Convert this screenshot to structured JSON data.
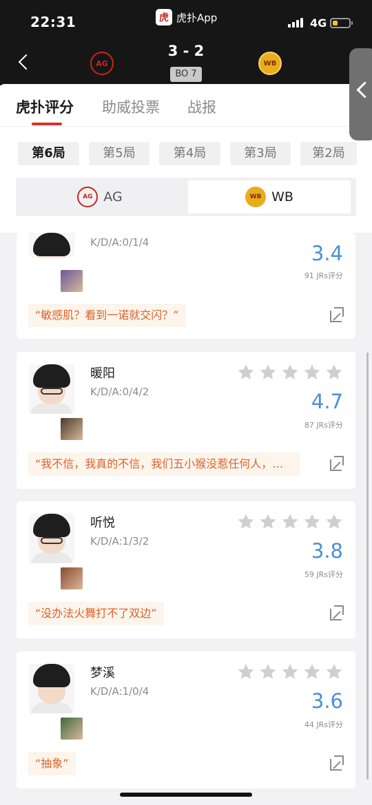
{
  "status_bar": {
    "time": "22:31",
    "app_name": "虎扑App",
    "app_logo_char": "虎",
    "network": "4G",
    "battery_level": 0.3
  },
  "match": {
    "score": "3 - 2",
    "format": "BO 7",
    "team_left_logo": "AG",
    "team_right_logo": "WB"
  },
  "tabs": [
    {
      "label": "虎扑评分",
      "active": true
    },
    {
      "label": "助威投票",
      "active": false
    },
    {
      "label": "战报",
      "active": false
    }
  ],
  "games": [
    {
      "label": "第6局",
      "active": true
    },
    {
      "label": "第5局",
      "active": false
    },
    {
      "label": "第4局",
      "active": false
    },
    {
      "label": "第3局",
      "active": false
    },
    {
      "label": "第2局",
      "active": false
    }
  ],
  "team_toggle": {
    "left": {
      "label": "AG",
      "active": false
    },
    "right": {
      "label": "WB",
      "active": true
    }
  },
  "players": [
    {
      "name": "",
      "kda": "K/D/A:0/1/4",
      "rating": "3.4",
      "votes": "91 JRs评分",
      "quote": "“敏感肌？看到一诺就交闪？”",
      "stars_filled": 0,
      "glasses": false,
      "hero_color": "#6a5a9a"
    },
    {
      "name": "暖阳",
      "kda": "K/D/A:0/4/2",
      "rating": "4.7",
      "votes": "87 JRs评分",
      "quote": "“我不信，我真的不信，我们五小猴没惹任何人，…",
      "stars_filled": 0,
      "glasses": true,
      "hero_color": "#4a3a2e"
    },
    {
      "name": "听悦",
      "kda": "K/D/A:1/3/2",
      "rating": "3.8",
      "votes": "59 JRs评分",
      "quote": "“没办法火舞打不了双边”",
      "stars_filled": 0,
      "glasses": true,
      "hero_color": "#8a4a30"
    },
    {
      "name": "梦溪",
      "kda": "K/D/A:1/0/4",
      "rating": "3.6",
      "votes": "44 JRs评分",
      "quote": "“抽象”",
      "stars_filled": 0,
      "glasses": false,
      "hero_color": "#3e6a40"
    }
  ],
  "colors": {
    "accent_red": "#d8322d",
    "rating_blue": "#4a8fd8",
    "quote_orange": "#d9632a",
    "star_gray": "#cfcfcf"
  }
}
